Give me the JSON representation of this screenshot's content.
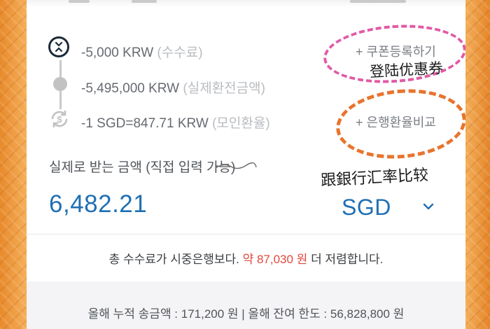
{
  "theme": {
    "accent": "#1f6fb3",
    "savings_red": "#e2483d",
    "annotation_pink": "#e05aa6",
    "annotation_orange": "#e8742e"
  },
  "fees": {
    "service_fee": {
      "amount": "-5,000 KRW",
      "note": "(수수료)",
      "icon": "coin-x-icon"
    },
    "exchange_amount": {
      "amount": "-5,495,000 KRW",
      "note": "(실제환전금액)",
      "icon": "timeline-dot-icon"
    },
    "rate": {
      "amount": "-1 SGD=847.71 KRW",
      "note": "(모인환율)",
      "icon": "dollar-exchange-icon"
    }
  },
  "links": {
    "coupon": "+ 쿠폰등록하기",
    "bank_compare": "+ 은행환율비교"
  },
  "annotations": {
    "coupon_note": "登陆优惠券",
    "compare_note": "跟銀行汇率比较"
  },
  "receive": {
    "label": "실제로 받는 금액 (직접 입력 가능)",
    "amount": "6,482.21",
    "currency": "SGD"
  },
  "savings": {
    "prefix": "총 수수료가 시중은행보다.",
    "amount": "약 87,030 원",
    "suffix": "더 저렴합니다."
  },
  "footer": {
    "limits": "올해 누적 송금액 : 171,200 원 | 올해 잔여 한도 : 56,828,800 원"
  }
}
